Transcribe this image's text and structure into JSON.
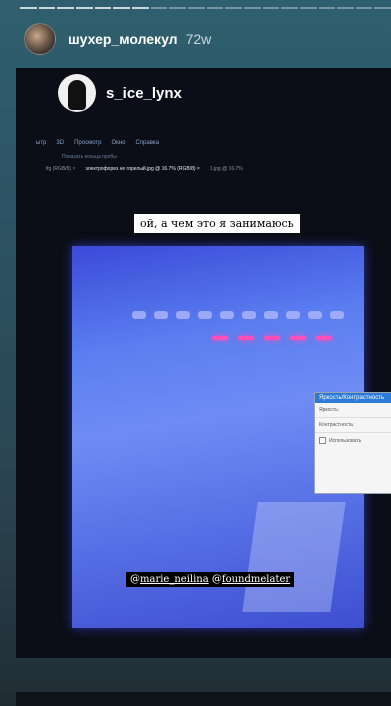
{
  "header": {
    "username": "шухер_молекул",
    "time": "72w"
  },
  "repost": {
    "username": "s_ice_lynx"
  },
  "screen": {
    "menu": [
      "ытр",
      "3D",
      "Просмотр",
      "Окно",
      "Справка"
    ],
    "toolbar_text": "Показать кольца пробы",
    "tabs": [
      "ifg (RGB/8) ×",
      "электрофорез не горелый.jpg @ 16.7% (RGB/8) ×",
      "1.jpg @ 16.7%"
    ]
  },
  "caption_top": "ой, а чем это я занимаюсь",
  "dialog": {
    "title": "Яркость/Контрастность",
    "brightness_label": "Яркость:",
    "contrast_label": "Контрастность:",
    "use_label": "Использовать"
  },
  "caption_bottom": {
    "prefix": "@",
    "mention1": "marie_neilina",
    "mention2_prefix": " @",
    "mention2": "foundmelater"
  }
}
